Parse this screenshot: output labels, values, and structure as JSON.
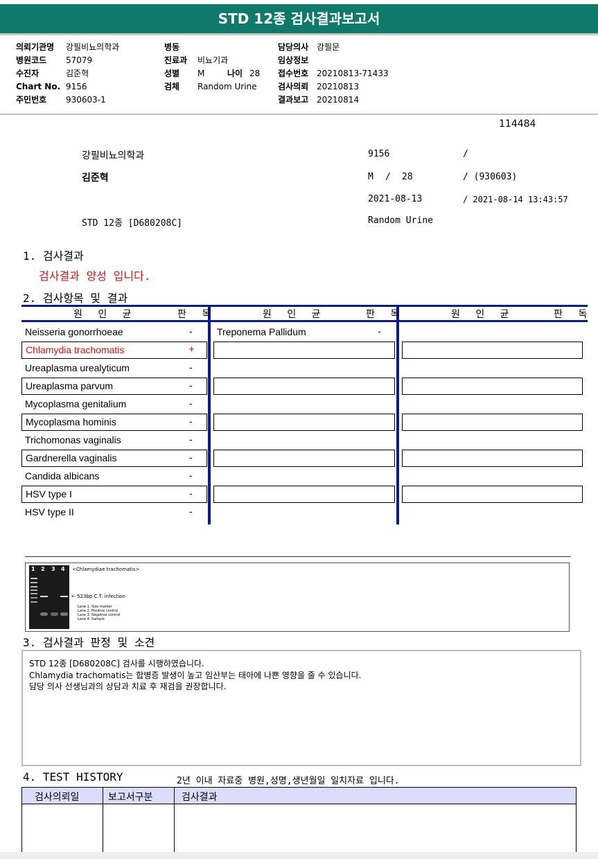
{
  "report": {
    "title": "STD 12종 검사결과보고서"
  },
  "header": {
    "left": [
      {
        "label": "의뢰기관명",
        "value": "강필비뇨의학과"
      },
      {
        "label": "병원코드",
        "value": "57079"
      },
      {
        "label": "수진자",
        "value": "김준혁"
      },
      {
        "label": "Chart No.",
        "value": "9156"
      },
      {
        "label": "주민번호",
        "value": "930603-1"
      }
    ],
    "middle": [
      {
        "label": "병동",
        "value": ""
      },
      {
        "label": "진료과",
        "value": "비뇨기과"
      },
      {
        "label": "성별",
        "value": "M"
      },
      {
        "label": "검체",
        "value": "Random Urine"
      }
    ],
    "age_label": "나이",
    "age_value": "28",
    "right": [
      {
        "label": "담당의사",
        "value": "강필문"
      },
      {
        "label": "임상정보",
        "value": ""
      },
      {
        "label": "접수번호",
        "value": "20210813-71433"
      },
      {
        "label": "검사의뢰",
        "value": "20210813"
      },
      {
        "label": "결과보고",
        "value": "20210814"
      }
    ]
  },
  "info": {
    "report_no": "114484",
    "clinic": "강필비뇨의학과",
    "chart_no": "9156",
    "slash": "/",
    "patient": "김준혁",
    "sex": "M",
    "sep": "/",
    "age": "28",
    "birth": "/ (930603)",
    "request_date": "2021-08-13",
    "report_datetime": "/ 2021-08-14 13:43:57",
    "test": "STD 12종 [D680208C]",
    "specimen": "Random Urine"
  },
  "sections": {
    "s1_title": "1. 검사결과",
    "s1_result": "검사결과 양성 입니다.",
    "s2_title": "2. 검사항목 및 결과",
    "s3_title": "3. 검사결과 판정 및 소견",
    "s4_title": "4. TEST HISTORY",
    "s4_note": "2년 이내 자료중 병원,성명,생년월일 일치자료 입니다."
  },
  "table": {
    "col_pathogen": "원 인 균",
    "col_result": "판 독",
    "rows": [
      {
        "name": "Neisseria gonorrhoeae",
        "result": "-",
        "positive": false
      },
      {
        "name": "Chlamydia trachomatis",
        "result": "+",
        "positive": true
      },
      {
        "name": "Ureaplasma urealyticum",
        "result": "-",
        "positive": false
      },
      {
        "name": "Ureaplasma parvum",
        "result": "-",
        "positive": false
      },
      {
        "name": "Mycoplasma genitalium",
        "result": "-",
        "positive": false
      },
      {
        "name": "Mycoplasma hominis",
        "result": "-",
        "positive": false
      },
      {
        "name": "Trichomonas vaginalis",
        "result": "-",
        "positive": false
      },
      {
        "name": "Gardnerella vaginalis",
        "result": "-",
        "positive": false
      },
      {
        "name": "Candida albicans",
        "result": "-",
        "positive": false
      },
      {
        "name": "HSV type I",
        "result": "-",
        "positive": false
      },
      {
        "name": "HSV type II",
        "result": "-",
        "positive": false
      }
    ],
    "col2_rows": [
      {
        "name": "Treponema Pallidum",
        "result": "-"
      }
    ]
  },
  "gel": {
    "lanes": [
      "1",
      "2",
      "3",
      "4"
    ],
    "caption": "<Chlamydiae trachomatis>",
    "band_label": "523bp C.T. infection",
    "legend": [
      "Lane 1. Size marker",
      "Lane 2. Positive control",
      "Lane 3. Negative control",
      "Lane 4. Sample"
    ]
  },
  "comment": {
    "lines": [
      "STD 12종 [D680208C] 검사를 시행하였습니다.",
      "Chlamydia trachomatis는 합병증 발생이 높고 임산부는 태아에 나쁜 영향을 줄 수 있습니다.",
      "담당 의사 선생님과의 상담과 치료 후 재검을 권장합니다."
    ]
  },
  "history": {
    "headers": [
      "검사의뢰일",
      "보고서구분",
      "검사결과"
    ]
  }
}
